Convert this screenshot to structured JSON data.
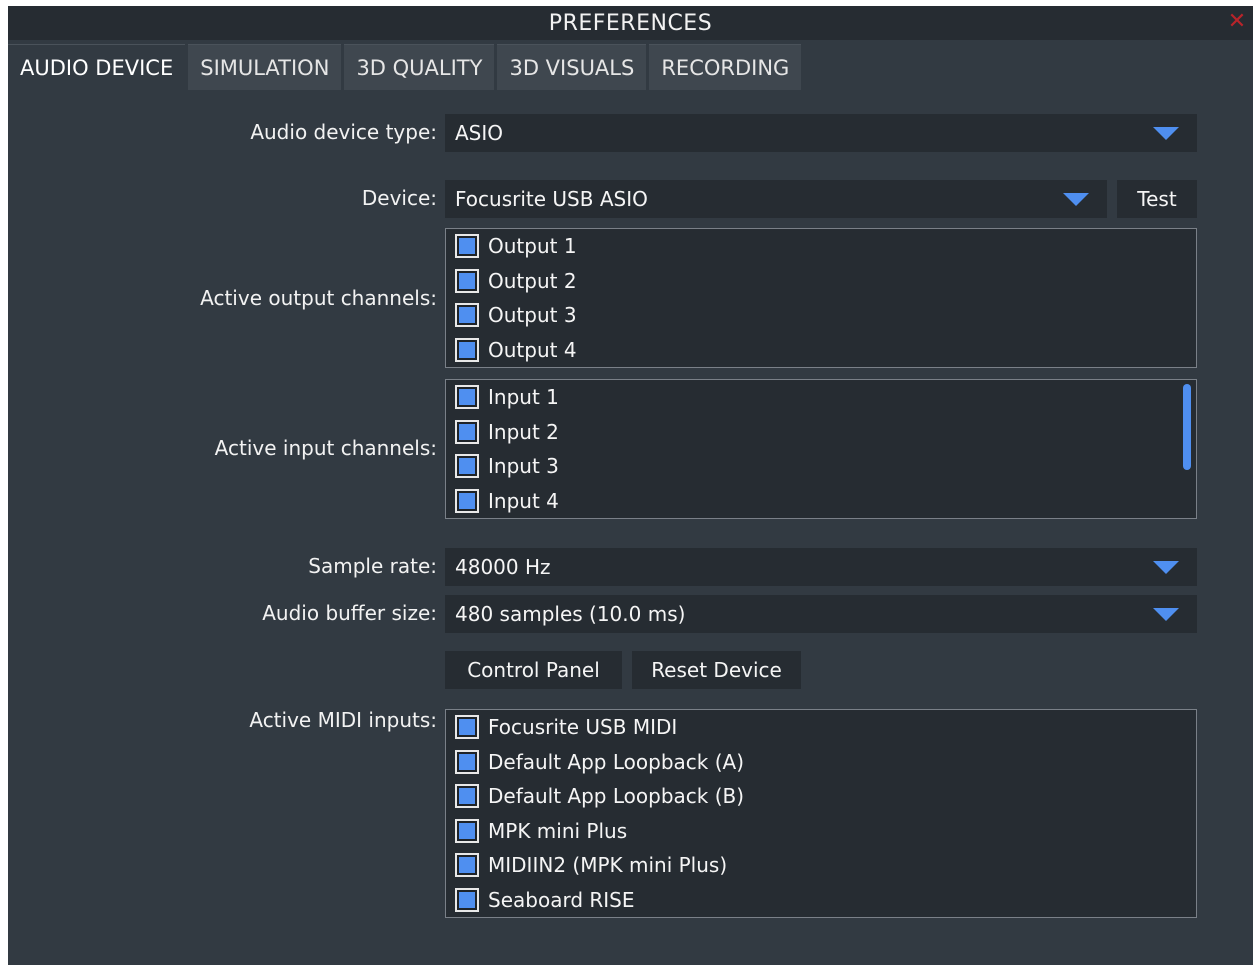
{
  "window": {
    "title": "PREFERENCES",
    "close_icon": "close-icon",
    "close_color": "#b8242a"
  },
  "tabs": [
    {
      "label": "AUDIO DEVICE",
      "active": true
    },
    {
      "label": "SIMULATION",
      "active": false
    },
    {
      "label": "3D QUALITY",
      "active": false
    },
    {
      "label": "3D VISUALS",
      "active": false
    },
    {
      "label": "RECORDING",
      "active": false
    }
  ],
  "audio_device_type": {
    "label": "Audio device type:",
    "value": "ASIO"
  },
  "device": {
    "label": "Device:",
    "value": "Focusrite USB ASIO",
    "test_label": "Test"
  },
  "output_channels": {
    "label": "Active output channels:",
    "items": [
      "Output 1",
      "Output 2",
      "Output 3",
      "Output 4"
    ]
  },
  "input_channels": {
    "label": "Active input channels:",
    "items": [
      "Input 1",
      "Input 2",
      "Input 3",
      "Input 4"
    ]
  },
  "sample_rate": {
    "label": "Sample rate:",
    "value": "48000 Hz"
  },
  "buffer_size": {
    "label": "Audio buffer size:",
    "value": "480 samples (10.0 ms)"
  },
  "buttons": {
    "control_panel": "Control Panel",
    "reset_device": "Reset Device"
  },
  "midi_inputs": {
    "label": "Active MIDI inputs:",
    "items": [
      "Focusrite USB MIDI",
      "Default App Loopback (A)",
      "Default App Loopback (B)",
      "MPK mini Plus",
      "MIDIIN2 (MPK mini Plus)",
      "Seaboard RISE"
    ]
  },
  "colors": {
    "accent": "#4f8ff0",
    "background": "#323a42",
    "field": "#262c32"
  }
}
